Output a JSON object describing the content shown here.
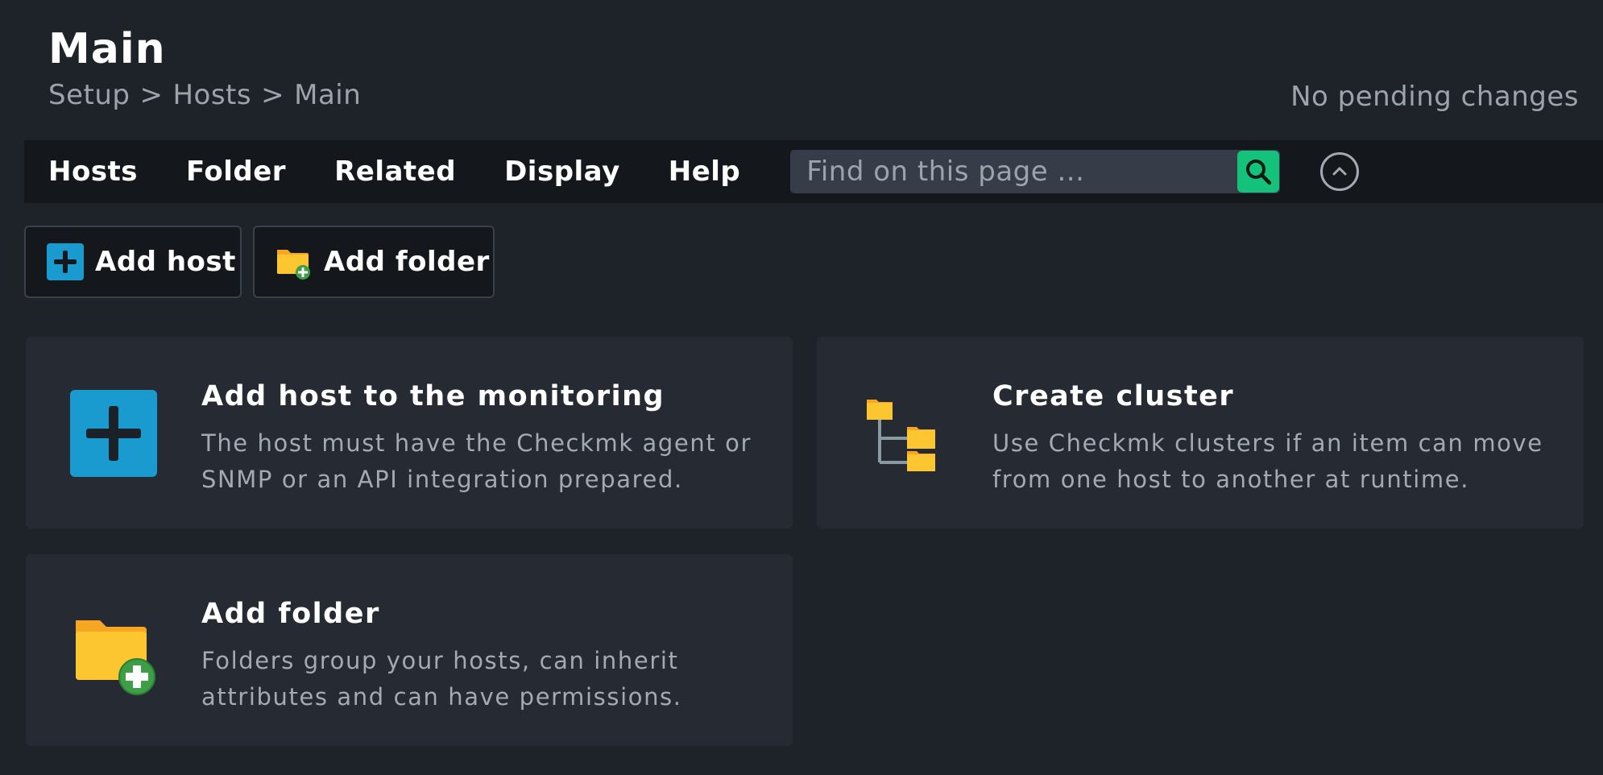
{
  "header": {
    "title": "Main",
    "breadcrumb": [
      "Setup",
      "Hosts",
      "Main"
    ],
    "breadcrumb_separator": ">",
    "pending_changes": "No pending changes"
  },
  "menubar": {
    "items": [
      "Hosts",
      "Folder",
      "Related",
      "Display",
      "Help"
    ],
    "search_placeholder": "Find on this page ..."
  },
  "actions": {
    "add_host": "Add host",
    "add_folder": "Add folder"
  },
  "cards": [
    {
      "title": "Add host to the monitoring",
      "description": "The host must have the Checkmk agent or SNMP or an API integration prepared.",
      "icon": "add-host-icon"
    },
    {
      "title": "Create cluster",
      "description": "Use Checkmk clusters if an item can move from one host to another at runtime.",
      "icon": "cluster-icon"
    },
    {
      "title": "Add folder",
      "description": "Folders group your hosts, can inherit attributes and can have permissions.",
      "icon": "add-folder-icon"
    }
  ],
  "colors": {
    "background": "#1e2229",
    "menubar": "#14181d",
    "card": "#262b33",
    "accent_green": "#15c27b",
    "accent_blue": "#1a9bcf",
    "folder_yellow": "#fcc631"
  }
}
